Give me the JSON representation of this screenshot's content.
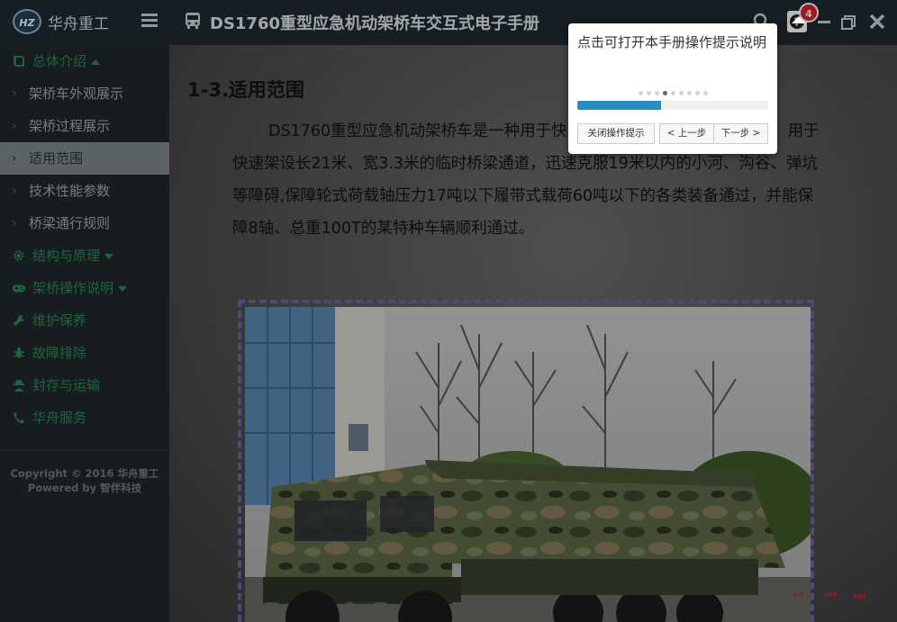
{
  "app": {
    "brand": "华舟重工",
    "logo_text": "HZ",
    "title": "DS1760重型应急机动架桥车交互式电子手册"
  },
  "help_badge": "4",
  "sidebar": {
    "items": [
      {
        "label": "总体介绍",
        "kind": "group",
        "icon": "book-icon",
        "caret": "up"
      },
      {
        "label": "架桥车外观展示",
        "kind": "sub"
      },
      {
        "label": "架桥过程展示",
        "kind": "sub"
      },
      {
        "label": "适用范围",
        "kind": "sub",
        "active": true
      },
      {
        "label": "技术性能参数",
        "kind": "sub"
      },
      {
        "label": "桥梁通行规则",
        "kind": "sub"
      },
      {
        "label": "结构与原理",
        "kind": "group",
        "icon": "gear-icon",
        "caret": "down"
      },
      {
        "label": "架桥操作说明",
        "kind": "group",
        "icon": "gamepad-icon",
        "caret": "down"
      },
      {
        "label": "维护保养",
        "kind": "group",
        "icon": "wrench-icon"
      },
      {
        "label": "故障排除",
        "kind": "group",
        "icon": "bug-icon"
      },
      {
        "label": "封存与运输",
        "kind": "group",
        "icon": "user-secret-icon"
      },
      {
        "label": "华舟服务",
        "kind": "group",
        "icon": "phone-icon"
      }
    ],
    "copyright_line1": "Copyright © 2016 华舟重工",
    "copyright_line2": "Powered by 智伴科技"
  },
  "content": {
    "section_title": "1-3.适用范围",
    "paragraph": "DS1760重型应急机动架桥车是一种用于快速架设和撤收作业的机械化桥，用于快速架设长21米、宽3.3米的临时桥梁通道，迅速克服19米以内的小河、沟谷、弹坑等障碍,保障轮式荷载轴压力17吨以下履带式载荷60吨以下的各类装备通过，并能保障8轴、总重100T的某特种车辆顺利通过。"
  },
  "tooltip": {
    "text": "点击可打开本手册操作提示说明",
    "dot_count": 9,
    "active_dot": 4,
    "progress": 0.44,
    "close_label": "关闭操作提示",
    "prev_label": "< 上一步",
    "next_label": "下一步 >"
  },
  "colors": {
    "accent_green": "#2e8a58",
    "progress_blue": "#2b8cc4",
    "badge_red": "#d8262b"
  }
}
